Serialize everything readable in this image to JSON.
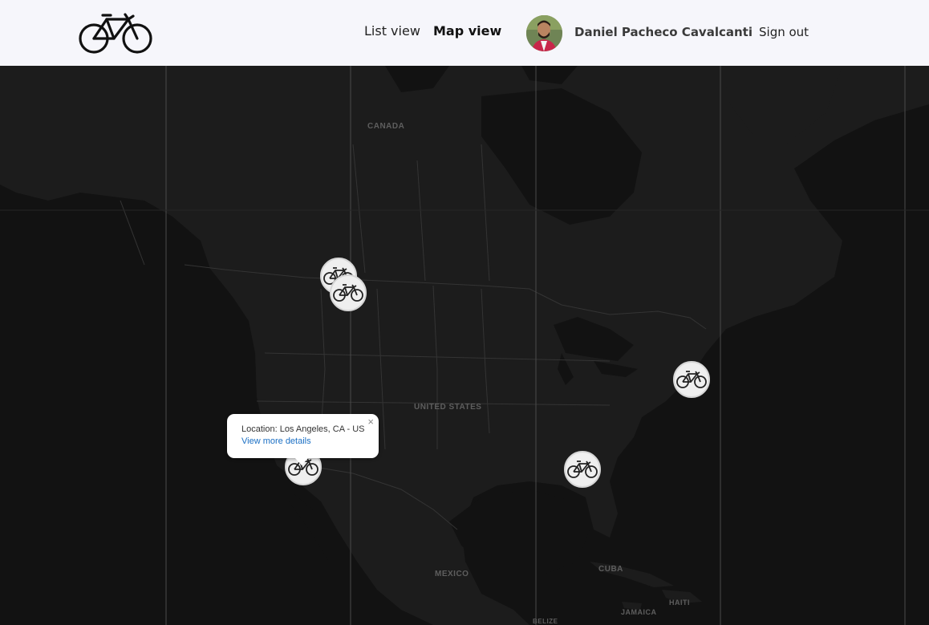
{
  "header": {
    "logo_icon": "bicycle-icon",
    "nav": {
      "list_view": "List view",
      "map_view": "Map view"
    },
    "user": {
      "name": "Daniel Pacheco Cavalcanti",
      "avatar_icon": "user-avatar"
    },
    "sign_out": "Sign out"
  },
  "map": {
    "labels": {
      "canada": "CANADA",
      "united_states": "UNITED STATES",
      "mexico": "MEXICO",
      "cuba": "CUBA",
      "haiti": "HAITI",
      "jamaica": "JAMAICA",
      "belize": "BELIZE"
    },
    "marker_icon": "bicycle-marker-icon",
    "popup": {
      "location": "Location: Los Angeles, CA - US",
      "link": "View more details",
      "close": "×"
    }
  },
  "colors": {
    "header_bg": "#f6f6fb",
    "map_bg": "#131313",
    "land": "#1c1c1c",
    "water": "#121212",
    "border": "#3a3a3a",
    "link": "#1a6fc4"
  }
}
